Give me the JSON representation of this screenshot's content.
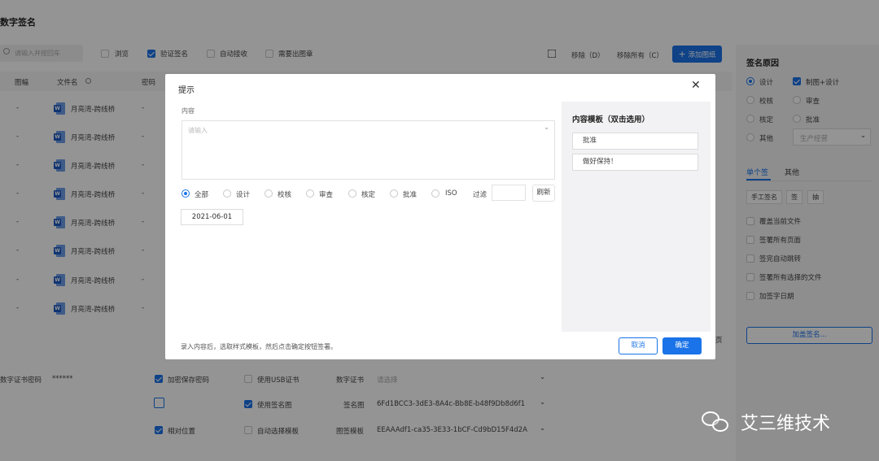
{
  "page": {
    "title": "数字签名",
    "toolbar": {
      "search_placeholder": "请输入并按回车",
      "browse": "浏览",
      "verify_sign": "验证签名",
      "auto_receive": "自动接收",
      "need_drawing": "需要出图章",
      "remove": "移除（D）",
      "remove_all": "移除所有（C）",
      "add_drawing": "添加图纸"
    },
    "table": {
      "col_seq": "图幅",
      "col_filename": "文件名",
      "col_pwd": "密码",
      "rows": [
        {
          "dash": "-",
          "name": "月亮湾-跨线桥",
          "pwd": "-"
        },
        {
          "dash": "-",
          "name": "月亮湾-跨线桥",
          "pwd": "-"
        },
        {
          "dash": "-",
          "name": "月亮湾-跨线桥",
          "pwd": "-"
        },
        {
          "dash": "-",
          "name": "月亮湾-跨线桥",
          "pwd": "-"
        },
        {
          "dash": "-",
          "name": "月亮湾-跨线桥",
          "pwd": "-"
        },
        {
          "dash": "-",
          "name": "月亮湾-跨线桥",
          "pwd": "-"
        },
        {
          "dash": "-",
          "name": "月亮湾-跨线桥",
          "pwd": "-"
        },
        {
          "dash": "-",
          "name": "月亮湾-跨线桥",
          "pwd": "-"
        }
      ]
    },
    "bottom": {
      "cert_pwd_label": "数字证书密码",
      "cert_pwd_value": "******",
      "remember_pwd": "加密保存密码",
      "use_usb": "使用USB证书",
      "digital_cert_label": "数字证书",
      "digital_cert_placeholder": "请选择",
      "use_sign_image": "使用签名图",
      "sign_image_label": "签名图",
      "sign_image_value": "6Fd1BCC3-3dE3-8A4c-Bb8E-b48f9Db8d6f1",
      "relative_pos": "相对位置",
      "auto_template": "自动选择模板",
      "template_label": "图签模板",
      "template_value": "EEAAAdf1-ca35-3E33-1bCF-Cd9bD15F4d2A"
    },
    "right_panel": {
      "title": "签名原因",
      "reasons": [
        {
          "label": "设计",
          "kind": "radio",
          "checked": true
        },
        {
          "label": "制图+设计",
          "kind": "checkbox",
          "checked": true
        },
        {
          "label": "校核",
          "kind": "radio",
          "checked": false
        },
        {
          "label": "审查",
          "kind": "radio",
          "checked": false
        },
        {
          "label": "核定",
          "kind": "radio",
          "checked": false
        },
        {
          "label": "批准",
          "kind": "radio",
          "checked": false
        },
        {
          "label": "其他",
          "kind": "radio",
          "checked": false
        }
      ],
      "other_select": "生产经营",
      "tab_single": "单个签",
      "tab_other": "其他",
      "chips": [
        "手工签名",
        "签",
        "抽"
      ],
      "options": [
        "覆盖当前文件",
        "签署所有页面",
        "签完自动跳转",
        "签署所有选择的文件",
        "加签字日期"
      ],
      "add_sign_button": "加盖签名..."
    },
    "right_edge_text": "页"
  },
  "modal": {
    "title": "提示",
    "content_label": "内容",
    "content_placeholder": "请输入",
    "filters": [
      {
        "label": "全部",
        "checked": true
      },
      {
        "label": "设计",
        "checked": false
      },
      {
        "label": "校核",
        "checked": false
      },
      {
        "label": "审查",
        "checked": false
      },
      {
        "label": "核定",
        "checked": false
      },
      {
        "label": "批准",
        "checked": false
      },
      {
        "label": "ISO",
        "checked": false
      }
    ],
    "filter_label": "过滤",
    "refresh": "刷新",
    "date_tag": "2021-06-01",
    "template_title": "内容模板（双击选用）",
    "templates": [
      "批准",
      "做好保持！"
    ],
    "hint": "录入内容后，选取样式模板，然后点击确定按钮签署。",
    "cancel": "取消",
    "ok": "确定"
  },
  "watermark": {
    "text": "艾三维技术"
  },
  "colors": {
    "accent": "#1a73e8",
    "overlay": "rgba(0,0,0,0.42)",
    "panel_bg": "#f4f4f6"
  }
}
